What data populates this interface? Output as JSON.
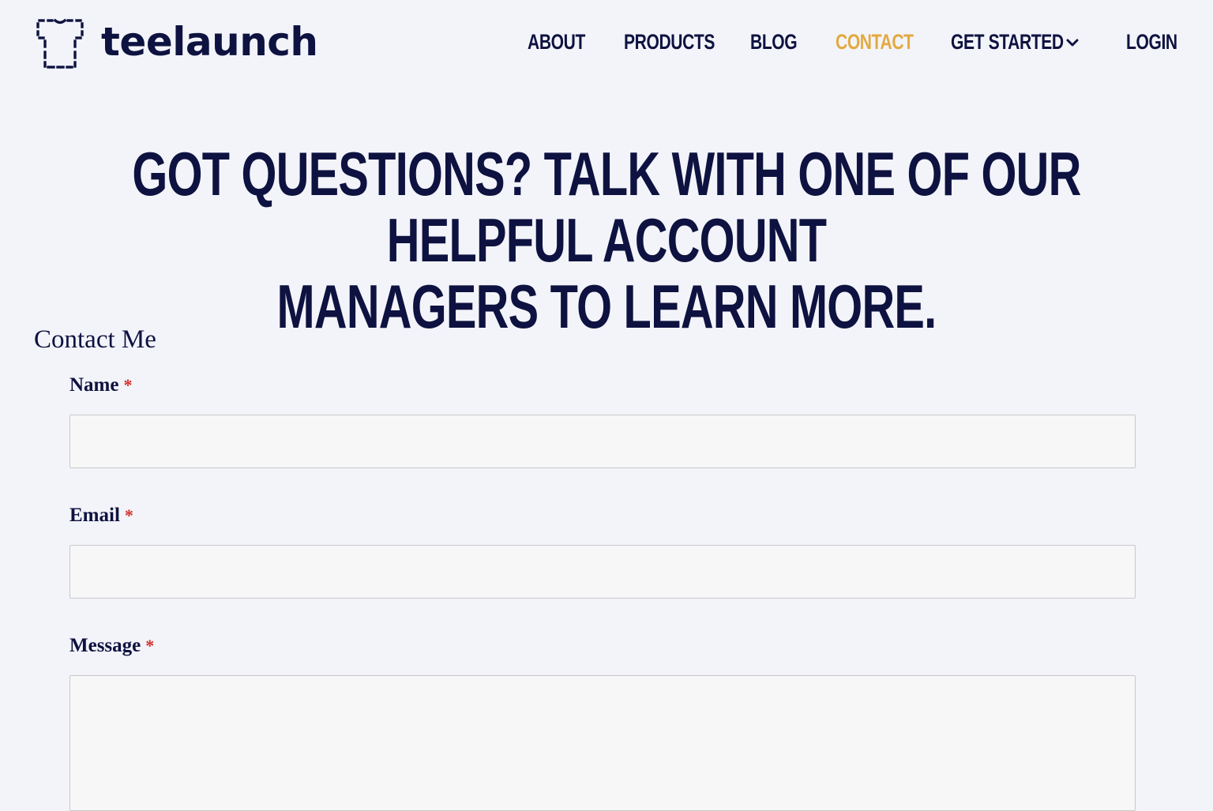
{
  "brand": {
    "name": "teelaunch",
    "logo_icon": "tshirt-dashed-icon"
  },
  "nav": {
    "items": [
      {
        "label": "ABOUT",
        "active": false
      },
      {
        "label": "PRODUCTS",
        "active": false
      },
      {
        "label": "BLOG",
        "active": false
      },
      {
        "label": "CONTACT",
        "active": true
      },
      {
        "label": "GET STARTED",
        "active": false,
        "has_dropdown": true
      },
      {
        "label": "LOGIN",
        "active": false
      }
    ],
    "active_color": "#e3a940",
    "text_color": "#0e1240"
  },
  "hero": {
    "line1": "GOT QUESTIONS? TALK WITH ONE OF OUR HELPFUL ACCOUNT",
    "line2": "MANAGERS TO LEARN MORE."
  },
  "form": {
    "title": "Contact Me",
    "required_marker": "*",
    "fields": {
      "name": {
        "label": "Name",
        "value": ""
      },
      "email": {
        "label": "Email",
        "value": ""
      },
      "message": {
        "label": "Message",
        "value": ""
      }
    }
  },
  "colors": {
    "background": "#f3f4f9",
    "required": "#d0322b",
    "input_bg": "#f7f7f7"
  }
}
